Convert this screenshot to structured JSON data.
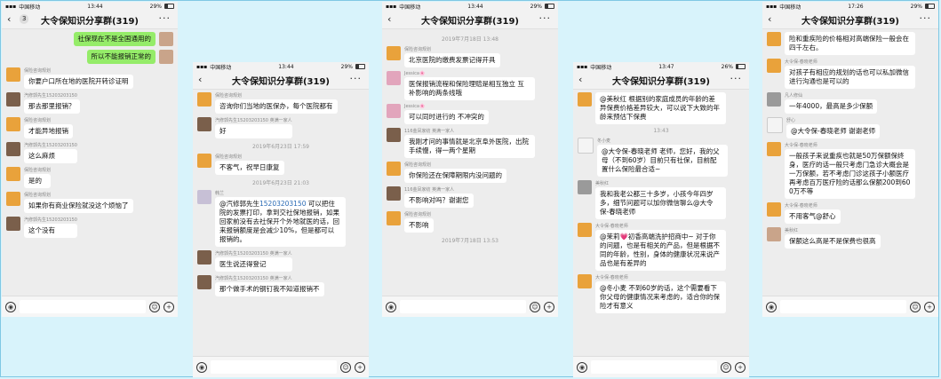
{
  "phones": [
    {
      "status": {
        "carrier": "中国移动",
        "time": "13:44",
        "battery": "29%",
        "battery_level": 0.29
      },
      "title": "大令保知识分享群(319)",
      "unread": "3",
      "items": [
        {
          "type": "msg",
          "side": "me",
          "text": "社保现在不是全国通用的"
        },
        {
          "type": "msg",
          "side": "me",
          "text": "所以不能报销正常的"
        },
        {
          "type": "msg",
          "side": "other",
          "nick": "保险咨询规划",
          "text": "你要户口所在地的医院开转诊证明"
        },
        {
          "type": "msg",
          "side": "other",
          "nick": "汽修郭先生15203203150",
          "text": "那去那里报销？"
        },
        {
          "type": "msg",
          "side": "other",
          "nick": "保险咨询规划",
          "text": "才能异地报销"
        },
        {
          "type": "msg",
          "side": "other",
          "nick": "汽修郭先生15203203150",
          "text": "这么麻烦"
        },
        {
          "type": "msg",
          "side": "other",
          "nick": "保险咨询规划",
          "text": "是的"
        },
        {
          "type": "msg",
          "side": "other",
          "nick": "保险咨询规划",
          "text": "如果你有商业保险就没这个烦恼了"
        },
        {
          "type": "msg",
          "side": "other",
          "nick": "汽修郭先生15203203150",
          "text": "这个没有"
        }
      ]
    },
    {
      "status": {
        "carrier": "中国移动",
        "time": "13:44",
        "battery": "29%",
        "battery_level": 0.29
      },
      "title": "大令保知识分享群(319)",
      "unread": "",
      "items": [
        {
          "type": "msg",
          "side": "other",
          "nick": "保险咨询规划",
          "text": "咨询你们当地的医保办，每个医院都有"
        },
        {
          "type": "msg",
          "side": "other",
          "nick": "汽修郭先生15203203150 英满一家人",
          "text": "好"
        },
        {
          "type": "time",
          "text": "2019年6月23日 17:59"
        },
        {
          "type": "msg",
          "side": "other",
          "nick": "保险咨询规划",
          "text": "不客气，祝早日康复"
        },
        {
          "type": "time",
          "text": "2019年6月23日 21:03"
        },
        {
          "type": "msg",
          "side": "other",
          "nick": "韩兰",
          "mention": "@汽修郭先生",
          "link": "15203203150",
          "text": " 可以把住院的发票打印，拿到交社保地报销，如果回家前没有去社保开个外地就医的话，回来报销额度是会减少10%，但是都可以报销的。"
        },
        {
          "type": "msg",
          "side": "other",
          "nick": "汽修郭先生15203203150 英满一家人",
          "text": "医生说还得登记"
        },
        {
          "type": "msg",
          "side": "other",
          "nick": "汽修郭先生15203203150 英满一家人",
          "text": "那个做手术的钢钉我不知道报销不"
        }
      ]
    },
    {
      "status": {
        "carrier": "中国移动",
        "time": "13:44",
        "battery": "29%",
        "battery_level": 0.29
      },
      "title": "大令保知识分享群(319)",
      "unread": "",
      "items": [
        {
          "type": "time",
          "text": "2019年7月18日 13:48"
        },
        {
          "type": "msg",
          "side": "other",
          "nick": "保险咨询规划",
          "text": "北京医院的缴费发票记得开具"
        },
        {
          "type": "msg",
          "side": "other",
          "nick": "Jessica🌸",
          "text": "医保报销流程和保险理赔是相互独立 互补影响的两条线哦"
        },
        {
          "type": "msg",
          "side": "other",
          "nick": "Jessica🌸",
          "text": "可以同时进行的 不冲突的"
        },
        {
          "type": "msg",
          "side": "other",
          "nick": "116金凤家纺 英满一家人",
          "text": "我刚才问的事情就是北京阜外医院，出院手续慢，得一两个星期"
        },
        {
          "type": "msg",
          "side": "other",
          "nick": "保险咨询规划",
          "text": "你保险还在保障期限内没问题的"
        },
        {
          "type": "msg",
          "side": "other",
          "nick": "116金凤家纺 英满一家人",
          "text": "不影响对吗？谢谢您"
        },
        {
          "type": "msg",
          "side": "other",
          "nick": "保险咨询规划",
          "text": "不影响"
        },
        {
          "type": "time",
          "text": "2019年7月18日 13:53"
        }
      ]
    },
    {
      "status": {
        "carrier": "中国移动",
        "time": "13:47",
        "battery": "26%",
        "battery_level": 0.26
      },
      "title": "大令保知识分享群(319)",
      "unread": "",
      "items": [
        {
          "type": "msg",
          "side": "other",
          "nick": "",
          "text": "@美秋红 根据别的家庭成员的年龄的差异保费价格差异较大，可以说下大致的年龄来预估下保费"
        },
        {
          "type": "time",
          "text": "13:43"
        },
        {
          "type": "msg",
          "side": "other",
          "nick": "冬小麦",
          "text": "@大令保-春晓老师 老师，您好，我的父母（不到60岁）目前只有社保，目前配置什么保险最合适~"
        },
        {
          "type": "msg",
          "side": "other",
          "nick": "美秋红",
          "text": "我和我老公都三十多岁，小孩今年四岁多，细节问题可以加你微信聊么@大令保-春晓老师"
        },
        {
          "type": "msg",
          "side": "other",
          "nick": "大令保-春晓老师",
          "text": "@茉莉💗初香高端洗护招商中~ 对于你的问题，也是有相关的产品，但是根据不同的年龄，性别，身体的健康状况来说产品也是有差异的"
        },
        {
          "type": "msg",
          "side": "other",
          "nick": "大令保-春晓老师",
          "text": "@冬小麦 不到60岁的话，这个需要看下你父母的健康情况来考虑的，适合你的保险才有意义"
        }
      ]
    },
    {
      "status": {
        "carrier": "中国移动",
        "time": "17:26",
        "battery": "29%",
        "battery_level": 0.29
      },
      "title": "大令保知识分享群(319)",
      "unread": "",
      "items": [
        {
          "type": "msg",
          "side": "other",
          "nick": "",
          "text": "险和重疾险的价格相对高端保险一般会在四千左右。"
        },
        {
          "type": "msg",
          "side": "other",
          "nick": "大令保-春晓老师",
          "text": "对孩子有相应的规划的话也可以私加微信进行沟通也是可以的"
        },
        {
          "type": "msg",
          "side": "other",
          "nick": "凡人修仙",
          "text": "一年4000，最高是多少保额"
        },
        {
          "type": "msg",
          "side": "other",
          "nick": "舒心",
          "text": "@大令保-春晓老师 谢谢老师"
        },
        {
          "type": "msg",
          "side": "other",
          "nick": "大令保-春晓老师",
          "text": "一般孩子来说重疾也就是50万保额保终身，医疗的话一般只考虑门急诊大概会是一万保额，若不考虑门诊这孩子小额医疗再考虑百万医疗险的话那么保额200到600万不等"
        },
        {
          "type": "msg",
          "side": "other",
          "nick": "大令保-春晓老师",
          "text": "不用客气@舒心"
        },
        {
          "type": "msg",
          "side": "other",
          "nick": "美秋红",
          "text": "保额这么高是不是保费也很高"
        }
      ]
    }
  ]
}
